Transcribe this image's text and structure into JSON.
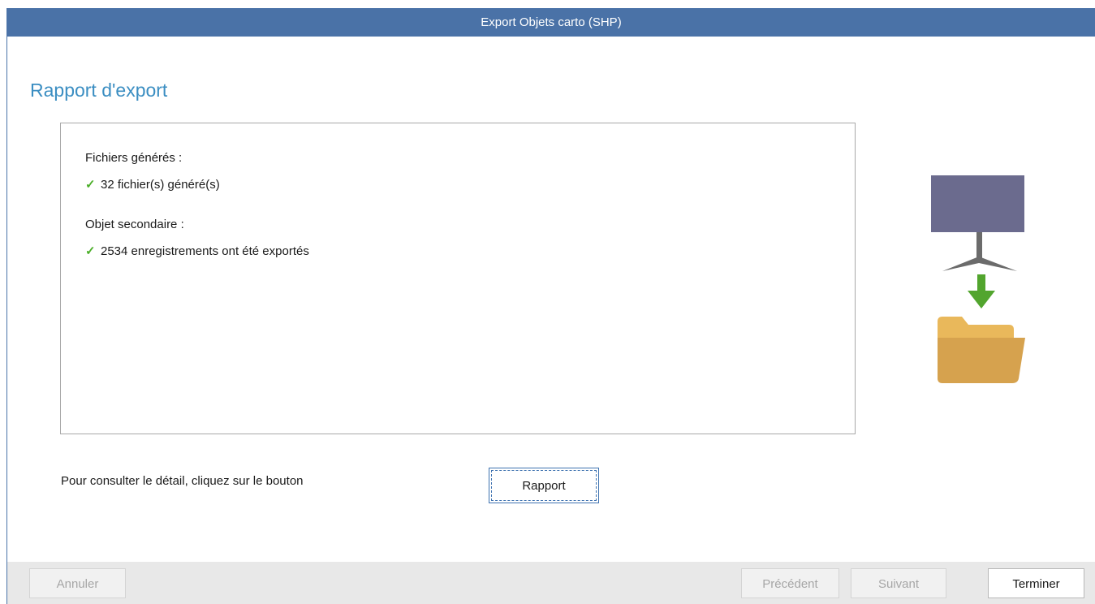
{
  "window": {
    "title": "Export Objets carto (SHP)"
  },
  "page": {
    "heading": "Rapport d'export"
  },
  "report": {
    "sections": [
      {
        "label": "Fichiers générés :",
        "status_icon": "check-icon",
        "message": "32 fichier(s) généré(s)"
      },
      {
        "label": "Objet secondaire :",
        "status_icon": "check-icon",
        "message": "2534 enregistrements ont été exportés"
      }
    ]
  },
  "detail": {
    "hint": "Pour consulter le détail, cliquez sur le bouton",
    "report_button_label": "Rapport"
  },
  "footer": {
    "cancel_label": "Annuler",
    "previous_label": "Précédent",
    "next_label": "Suivant",
    "finish_label": "Terminer"
  },
  "illustration": {
    "icons": [
      "monitor-icon",
      "download-arrow-icon",
      "folder-icon"
    ]
  },
  "colors": {
    "titlebar": "#4a72a7",
    "heading": "#3b8ec2",
    "check": "#4caf2a",
    "monitor": "#6b6b8e",
    "arrow": "#52a52e",
    "folder": "#d6a24e"
  }
}
